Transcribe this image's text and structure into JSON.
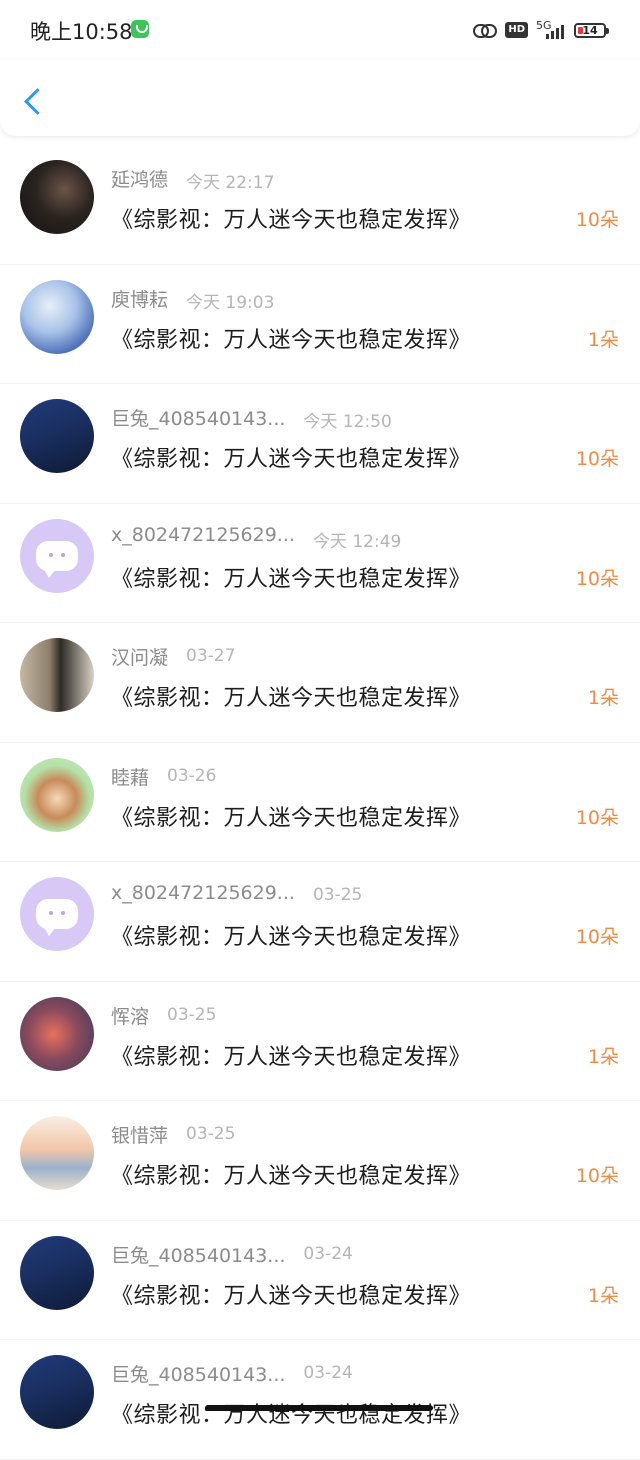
{
  "status_bar": {
    "time": "晚上10:58",
    "network": "5G",
    "hd": "HD",
    "battery_level": "14"
  },
  "colors": {
    "accent_blue": "#2a9bf0",
    "count_orange": "#ef8c46",
    "name_gray": "#8c8c8c",
    "time_gray": "#b5b5b5",
    "default_avatar_purple": "#d7c8f5"
  },
  "header": {
    "back_icon": "chevron-left-icon"
  },
  "list": [
    {
      "avatar": "av-dark",
      "name": "延鸿德",
      "time": "今天 22:17",
      "title": "《综影视：万人迷今天也稳定发挥》",
      "count": "10朵"
    },
    {
      "avatar": "av-blue-figure",
      "name": "庾博耘",
      "time": "今天 19:03",
      "title": "《综影视：万人迷今天也稳定发挥》",
      "count": "1朵"
    },
    {
      "avatar": "av-dark-blue",
      "name": "巨兔_408540143...",
      "time": "今天 12:50",
      "title": "《综影视：万人迷今天也稳定发挥》",
      "count": "10朵"
    },
    {
      "avatar": "av-default",
      "name": "x_802472125629...",
      "time": "今天 12:49",
      "title": "《综影视：万人迷今天也稳定发挥》",
      "count": "10朵"
    },
    {
      "avatar": "av-photo-man",
      "name": "汉问凝",
      "time": "03-27",
      "title": "《综影视：万人迷今天也稳定发挥》",
      "count": "1朵"
    },
    {
      "avatar": "av-cartoon-green",
      "name": "睦藉",
      "time": "03-26",
      "title": "《综影视：万人迷今天也稳定发挥》",
      "count": "10朵"
    },
    {
      "avatar": "av-default",
      "name": "x_802472125629...",
      "time": "03-25",
      "title": "《综影视：万人迷今天也稳定发挥》",
      "count": "10朵"
    },
    {
      "avatar": "av-cartoon-fish",
      "name": "恽溶",
      "time": "03-25",
      "title": "《综影视：万人迷今天也稳定发挥》",
      "count": "1朵"
    },
    {
      "avatar": "av-sunset",
      "name": "银惜萍",
      "time": "03-25",
      "title": "《综影视：万人迷今天也稳定发挥》",
      "count": "10朵"
    },
    {
      "avatar": "av-dark-blue",
      "name": "巨兔_408540143...",
      "time": "03-24",
      "title": "《综影视：万人迷今天也稳定发挥》",
      "count": "1朵"
    },
    {
      "avatar": "av-dark-blue",
      "name": "巨兔_408540143...",
      "time": "03-24",
      "title": "《综影视：万人迷今天也稳定发挥》",
      "count": ""
    }
  ]
}
